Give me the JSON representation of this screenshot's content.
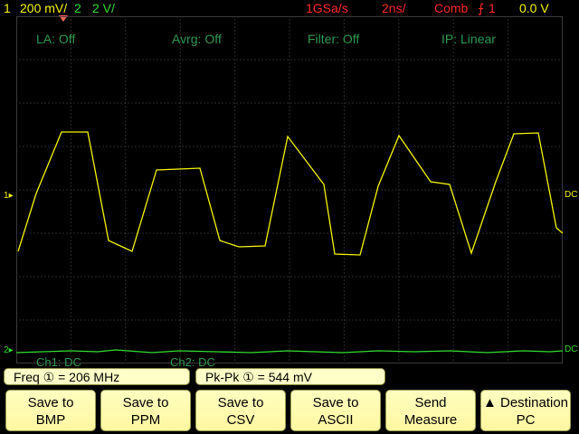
{
  "status_bar": {
    "ch1_number": "1",
    "ch1_scale": "200 mV/",
    "ch2_number": "2",
    "ch2_scale": "2 V/",
    "sample_rate": "1GSa/s",
    "timebase": "2ns/",
    "trigger_mode": "Comb",
    "trigger_channel": "1",
    "trigger_level": "0.0 V"
  },
  "overlay": {
    "la": "LA: Off",
    "avrg": "Avrg: Off",
    "filter": "Filter: Off",
    "ip": "IP: Linear",
    "ch1_coupling": "Ch1: DC",
    "ch2_coupling": "Ch2: DC"
  },
  "markers": {
    "ch1": "1",
    "ch2": "2",
    "ch1_right": "DC",
    "ch2_right": "DC"
  },
  "measurements": {
    "freq": "Freq ① = 206 MHz",
    "pkpk": "Pk-Pk ① = 544 mV"
  },
  "softkeys": [
    {
      "line1": "Save to",
      "line2": "BMP"
    },
    {
      "line1": "Save to",
      "line2": "PPM"
    },
    {
      "line1": "Save to",
      "line2": "CSV"
    },
    {
      "line1": "Save to",
      "line2": "ASCII"
    },
    {
      "line1": "Send",
      "line2": "Measure"
    },
    {
      "line1": "▲ Destination",
      "line2": "PC"
    }
  ],
  "colors": {
    "ch1": "#f5f500",
    "ch2": "#33dd33",
    "status_red": "#ff2a2a",
    "grid": "#555555",
    "softkey_bg": "#ffffc0"
  }
}
